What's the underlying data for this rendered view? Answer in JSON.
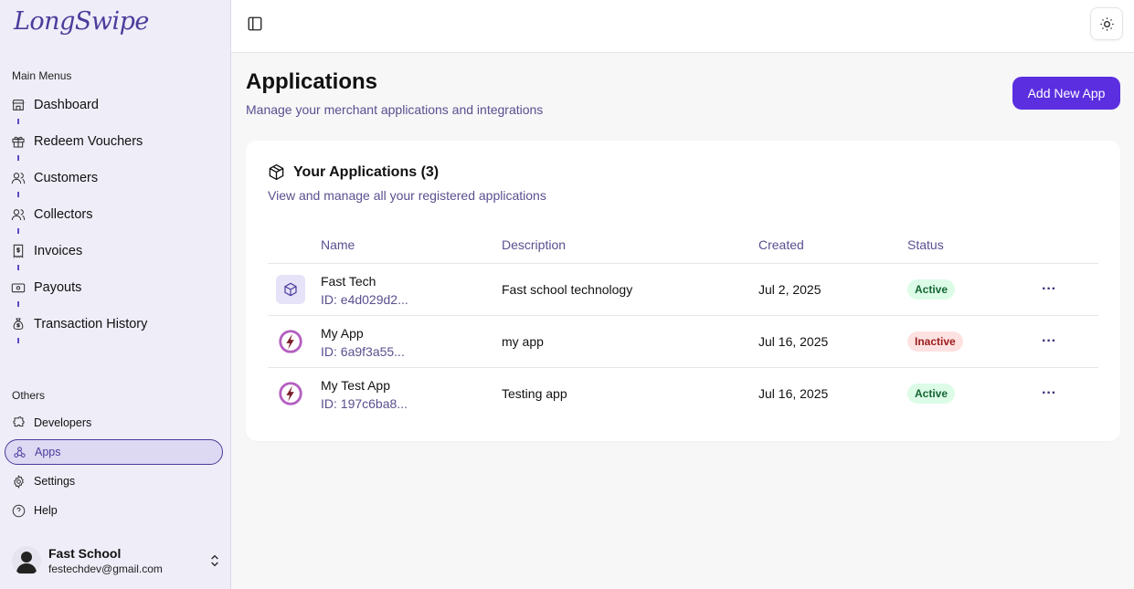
{
  "brand": {
    "logo_text": "LongSwipe"
  },
  "sidebar": {
    "main_label": "Main Menus",
    "main_items": [
      {
        "label": "Dashboard",
        "icon": "store-icon"
      },
      {
        "label": "Redeem Vouchers",
        "icon": "gift-icon"
      },
      {
        "label": "Customers",
        "icon": "users-icon"
      },
      {
        "label": "Collectors",
        "icon": "users-icon"
      },
      {
        "label": "Invoices",
        "icon": "receipt-icon"
      },
      {
        "label": "Payouts",
        "icon": "wallet-icon"
      },
      {
        "label": "Transaction History",
        "icon": "money-bag-icon"
      }
    ],
    "others_label": "Others",
    "other_items": [
      {
        "label": "Developers",
        "icon": "puzzle-icon"
      },
      {
        "label": "Apps",
        "icon": "webhook-icon",
        "active": true
      },
      {
        "label": "Settings",
        "icon": "gear-icon"
      },
      {
        "label": "Help",
        "icon": "help-circle-icon"
      }
    ],
    "user": {
      "name": "Fast School",
      "email": "festechdev@gmail.com"
    }
  },
  "header": {
    "toggle_icon": "sidebar-toggle-icon",
    "theme_icon": "sun-icon"
  },
  "page": {
    "title": "Applications",
    "subtitle": "Manage your merchant applications and integrations",
    "add_button": "Add New App"
  },
  "card": {
    "title": "Your Applications (3)",
    "subtitle": "View and manage all your registered applications",
    "columns": {
      "name": "Name",
      "description": "Description",
      "created": "Created",
      "status": "Status"
    },
    "rows": [
      {
        "name": "Fast Tech",
        "id": "ID: e4d029d2...",
        "description": "Fast school technology",
        "created": "Jul 2, 2025",
        "status": "Active",
        "icon": "package-icon"
      },
      {
        "name": "My App",
        "id": "ID: 6a9f3a55...",
        "description": "my app",
        "created": "Jul 16, 2025",
        "status": "Inactive",
        "icon": "lightning-logo-icon"
      },
      {
        "name": "My Test App",
        "id": "ID: 197c6ba8...",
        "description": "Testing app",
        "created": "Jul 16, 2025",
        "status": "Active",
        "icon": "lightning-logo-icon"
      }
    ],
    "more_label": "···"
  },
  "colors": {
    "accent": "#5b2ee0",
    "brand": "#4b3c9c",
    "active_bg": "#dcfce7",
    "inactive_bg": "#fee2e2"
  }
}
